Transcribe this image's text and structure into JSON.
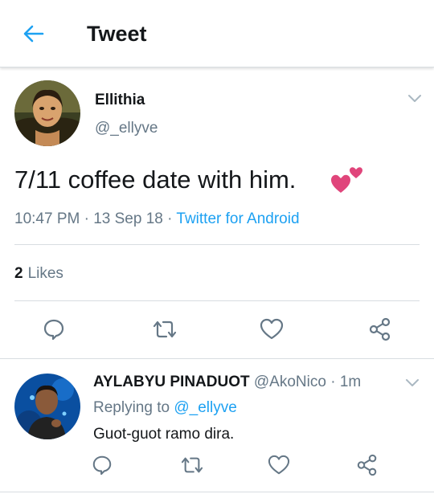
{
  "header": {
    "title": "Tweet",
    "back_icon": "arrow-left-icon"
  },
  "tweet": {
    "display_name": "Ellithia",
    "handle": "@_ellyve",
    "text": "7/11 coffee date with him.",
    "emoji": "two-hearts-icon",
    "time": "10:47 PM",
    "date": "13 Sep 18",
    "separator": " · ",
    "source": "Twitter for Android",
    "likes_count": "2",
    "likes_label": "Likes"
  },
  "reply": {
    "display_name": "AYLABYU PINADUOT",
    "handle": "@AkoNico",
    "time": "1m",
    "separator": " · ",
    "replying_label": "Replying to ",
    "replying_to": "@_ellyve",
    "text": "Guot-guot ramo dira."
  },
  "colors": {
    "accent": "#1da1f2",
    "secondary_text": "#657786",
    "primary_text": "#14171a",
    "icon_gray": "#657786",
    "heart_pink": "#e0457b"
  }
}
